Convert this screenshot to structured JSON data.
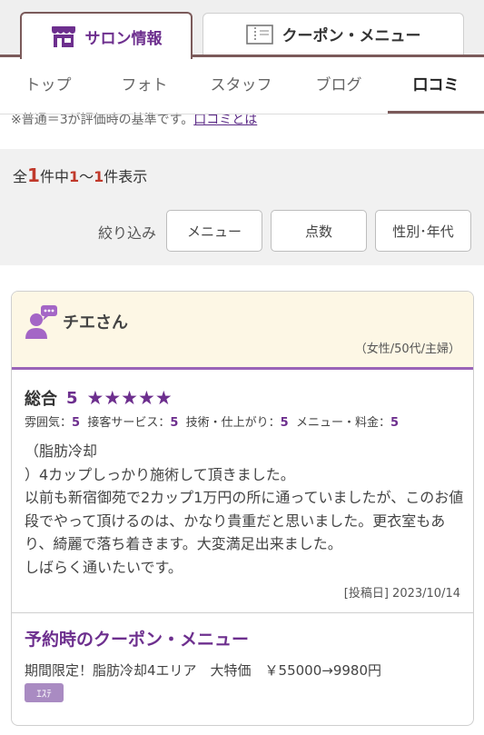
{
  "top_tabs": {
    "salon_info": "サロン情報",
    "coupon_menu": "クーポン・メニュー"
  },
  "subnav": [
    "トップ",
    "フォト",
    "スタッフ",
    "ブログ",
    "口コミ"
  ],
  "note": {
    "text": "※普通＝3が評価時の基準です。",
    "link": "口コミとは"
  },
  "results": {
    "prefix": "全",
    "total": "1",
    "mid": "件中",
    "from": "1",
    "tilde": "〜",
    "to": "1",
    "suffix": "件表示"
  },
  "filter": {
    "label": "絞り込み",
    "buttons": [
      "メニュー",
      "点数",
      "性別･年代"
    ]
  },
  "review": {
    "reviewer": "チエさん",
    "demographic": "（女性/50代/主婦）",
    "total_label": "総合",
    "total_score": "5",
    "stars": "★★★★★",
    "subscores": [
      {
        "label": "雰囲気：",
        "value": "5"
      },
      {
        "label": "接客サービス：",
        "value": "5"
      },
      {
        "label": "技術・仕上がり：",
        "value": "5"
      },
      {
        "label": "メニュー・料金：",
        "value": "5"
      }
    ],
    "body": "（脂肪冷却\n）4カップしっかり施術して頂きました。\n以前も新宿御苑で2カップ1万円の所に通っていましたが、このお値段でやって頂けるのは、かなり貴重だと思いました。更衣室もあり、綺麗で落ち着きます。大変満足出来ました。\nしばらく通いたいです。",
    "posted": "[投稿日] 2023/10/14"
  },
  "coupon": {
    "title": "予約時のクーポン・メニュー",
    "text": "期間限定！脂肪冷却4エリア　大特価　￥55000→9980円",
    "tag": "ｴｽﾃ"
  },
  "colors": {
    "accent": "#6d2f8e",
    "tab_border": "#7b5a5a",
    "highlight": "#c0392b",
    "card_header": "#fdf7e5"
  }
}
